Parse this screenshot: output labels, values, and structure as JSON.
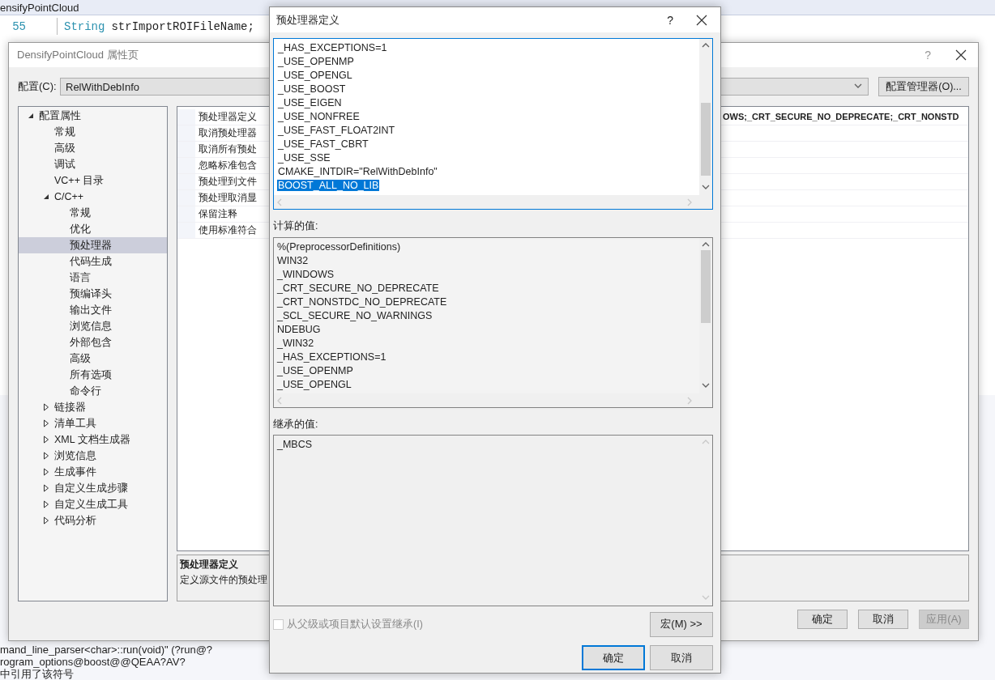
{
  "ide": {
    "tab_title": "ensifyPointCloud",
    "code_lines": [
      {
        "number": "55",
        "type": "String",
        "code": "strImportROIFileName;"
      }
    ],
    "output_lines": [
      "mand_line_parser<char>::run(void)\" (?run@?",
      "rogram_options@boost@@QEAA?AV?",
      "中引用了该符号"
    ]
  },
  "property_window": {
    "title": "DensifyPointCloud 属性页",
    "help": "?",
    "config_label": "配置(C):",
    "config_value": "RelWithDebInfo",
    "config_manager_button": "配置管理器(O)...",
    "tree": [
      {
        "label": "配置属性",
        "expanded": true,
        "selected": false,
        "children": [
          {
            "label": "常规",
            "selected": false
          },
          {
            "label": "高级",
            "selected": false
          },
          {
            "label": "调试",
            "selected": false
          },
          {
            "label": "VC++ 目录",
            "selected": false
          },
          {
            "label": "C/C++",
            "expanded": true,
            "selected": false,
            "children": [
              {
                "label": "常规",
                "selected": false
              },
              {
                "label": "优化",
                "selected": false
              },
              {
                "label": "预处理器",
                "selected": true
              },
              {
                "label": "代码生成",
                "selected": false
              },
              {
                "label": "语言",
                "selected": false
              },
              {
                "label": "预编译头",
                "selected": false
              },
              {
                "label": "输出文件",
                "selected": false
              },
              {
                "label": "浏览信息",
                "selected": false
              },
              {
                "label": "外部包含",
                "selected": false
              },
              {
                "label": "高级",
                "selected": false
              },
              {
                "label": "所有选项",
                "selected": false
              },
              {
                "label": "命令行",
                "selected": false
              }
            ]
          },
          {
            "label": "链接器",
            "expanded": false,
            "selected": false
          },
          {
            "label": "清单工具",
            "expanded": false,
            "selected": false
          },
          {
            "label": "XML 文档生成器",
            "expanded": false,
            "selected": false
          },
          {
            "label": "浏览信息",
            "expanded": false,
            "selected": false
          },
          {
            "label": "生成事件",
            "expanded": false,
            "selected": false
          },
          {
            "label": "自定义生成步骤",
            "expanded": false,
            "selected": false
          },
          {
            "label": "自定义生成工具",
            "expanded": false,
            "selected": false
          },
          {
            "label": "代码分析",
            "expanded": false,
            "selected": false
          }
        ]
      }
    ],
    "properties": [
      {
        "name": "预处理器定义",
        "value": "OWS;_CRT_SECURE_NO_DEPRECATE;_CRT_NONSTD"
      },
      {
        "name": "取消预处理器"
      },
      {
        "name": "取消所有预处"
      },
      {
        "name": "忽略标准包含"
      },
      {
        "name": "预处理到文件"
      },
      {
        "name": "预处理取消显"
      },
      {
        "name": "保留注释"
      },
      {
        "name": "使用标准符合"
      }
    ],
    "description": {
      "title": "预处理器定义",
      "text": "定义源文件的预处理"
    },
    "buttons": [
      {
        "label": "确定",
        "disabled": false
      },
      {
        "label": "取消",
        "disabled": false
      },
      {
        "label": "应用(A)",
        "disabled": true
      }
    ]
  },
  "dialog": {
    "title": "预处理器定义",
    "help": "?",
    "definitions": [
      {
        "text": "_HAS_EXCEPTIONS=1",
        "selected": false
      },
      {
        "text": "_USE_OPENMP",
        "selected": false
      },
      {
        "text": "_USE_OPENGL",
        "selected": false
      },
      {
        "text": "_USE_BOOST",
        "selected": false
      },
      {
        "text": "_USE_EIGEN",
        "selected": false
      },
      {
        "text": "_USE_NONFREE",
        "selected": false
      },
      {
        "text": "_USE_FAST_FLOAT2INT",
        "selected": false
      },
      {
        "text": "_USE_FAST_CBRT",
        "selected": false
      },
      {
        "text": "_USE_SSE",
        "selected": false
      },
      {
        "text": "CMAKE_INTDIR=\"RelWithDebInfo\"",
        "selected": false
      },
      {
        "text": "BOOST_ALL_NO_LIB",
        "selected": true
      }
    ],
    "computed_label": "计算的值:",
    "computed_values": [
      "%(PreprocessorDefinitions)",
      "WIN32",
      "_WINDOWS",
      "_CRT_SECURE_NO_DEPRECATE",
      "_CRT_NONSTDC_NO_DEPRECATE",
      "_SCL_SECURE_NO_WARNINGS",
      "NDEBUG",
      "_WIN32",
      "_HAS_EXCEPTIONS=1",
      "_USE_OPENMP",
      "_USE_OPENGL"
    ],
    "inherited_label": "继承的值:",
    "inherited_values": [
      "_MBCS"
    ],
    "inherit_checkbox": {
      "label": "从父级或项目默认设置继承(I)",
      "checked": false,
      "disabled": true
    },
    "macros_button": "宏(M) >>",
    "buttons": [
      {
        "label": "确定",
        "default": true
      },
      {
        "label": "取消",
        "default": false
      }
    ]
  }
}
